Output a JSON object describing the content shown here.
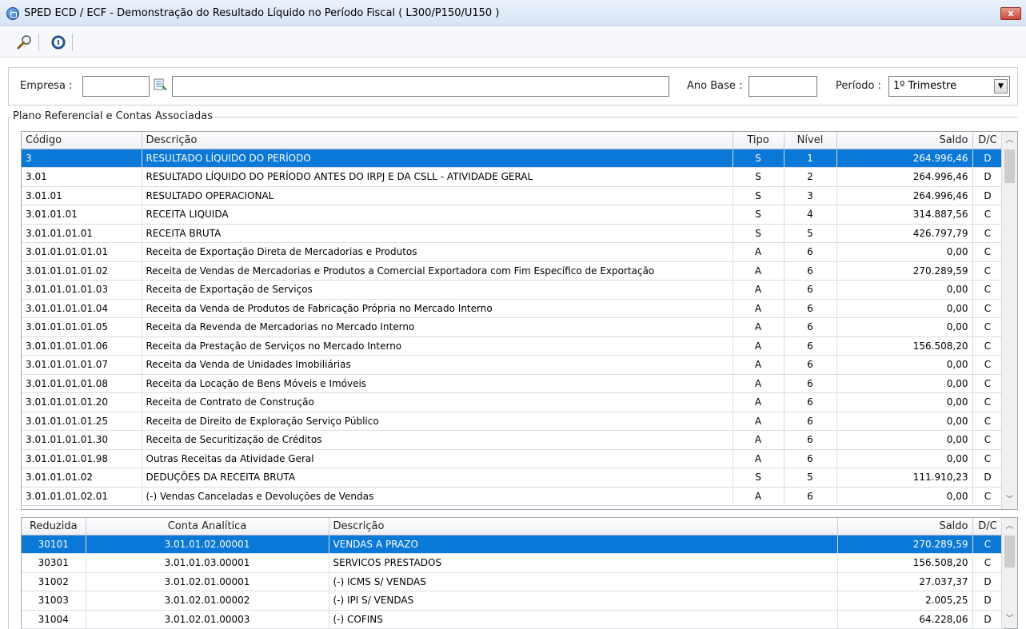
{
  "window": {
    "title": "SPED ECD / ECF - Demonstração do Resultado Líquido no Período Fiscal ( L300/P150/U150 )",
    "close_label": "x"
  },
  "toolbar": {
    "buttons": [
      {
        "icon": "search-icon"
      },
      {
        "icon": "info-icon"
      }
    ]
  },
  "filter": {
    "empresa_label": "Empresa :",
    "empresa_code": "",
    "empresa_name": "",
    "ano_base_label": "Ano Base :",
    "ano_base_value": "",
    "periodo_label": "Período :",
    "periodo_value": "1º Trimestre"
  },
  "group_title": "Plano Referencial e Contas Associadas",
  "grid1": {
    "columns": [
      "Código",
      "Descrição",
      "Tipo",
      "Nível",
      "Saldo",
      "D/C"
    ],
    "rows": [
      [
        "3",
        "RESULTADO LÍQUIDO DO PERÍODO",
        "S",
        "1",
        "264.996,46",
        "D"
      ],
      [
        "3.01",
        "RESULTADO LÍQUIDO DO PERÍODO ANTES DO IRPJ E DA CSLL - ATIVIDADE GERAL",
        "S",
        "2",
        "264.996,46",
        "D"
      ],
      [
        "3.01.01",
        "RESULTADO OPERACIONAL",
        "S",
        "3",
        "264.996,46",
        "D"
      ],
      [
        "3.01.01.01",
        "RECEITA LIQUIDA",
        "S",
        "4",
        "314.887,56",
        "C"
      ],
      [
        "3.01.01.01.01",
        "RECEITA BRUTA",
        "S",
        "5",
        "426.797,79",
        "C"
      ],
      [
        "3.01.01.01.01.01",
        "Receita de Exportação Direta de Mercadorias e Produtos",
        "A",
        "6",
        "0,00",
        "C"
      ],
      [
        "3.01.01.01.01.02",
        "Receita de Vendas de Mercadorias e Produtos a Comercial Exportadora com Fim Específico de Exportação",
        "A",
        "6",
        "270.289,59",
        "C"
      ],
      [
        "3.01.01.01.01.03",
        "Receita de Exportação de Serviços",
        "A",
        "6",
        "0,00",
        "C"
      ],
      [
        "3.01.01.01.01.04",
        "Receita da Venda de Produtos de Fabricação Própria no Mercado Interno",
        "A",
        "6",
        "0,00",
        "C"
      ],
      [
        "3.01.01.01.01.05",
        "Receita da Revenda de Mercadorias no Mercado Interno",
        "A",
        "6",
        "0,00",
        "C"
      ],
      [
        "3.01.01.01.01.06",
        "Receita da Prestação de Serviços no Mercado Interno",
        "A",
        "6",
        "156.508,20",
        "C"
      ],
      [
        "3.01.01.01.01.07",
        "Receita da Venda de Unidades Imobiliárias",
        "A",
        "6",
        "0,00",
        "C"
      ],
      [
        "3.01.01.01.01.08",
        "Receita da Locação de Bens Móveis e Imóveis",
        "A",
        "6",
        "0,00",
        "C"
      ],
      [
        "3.01.01.01.01.20",
        "Receita de Contrato de Construção",
        "A",
        "6",
        "0,00",
        "C"
      ],
      [
        "3.01.01.01.01.25",
        "Receita de Direito de Exploração Serviço Público",
        "A",
        "6",
        "0,00",
        "C"
      ],
      [
        "3.01.01.01.01.30",
        "Receita de Securitização de Créditos",
        "A",
        "6",
        "0,00",
        "C"
      ],
      [
        "3.01.01.01.01.98",
        "Outras Receitas da Atividade Geral",
        "A",
        "6",
        "0,00",
        "C"
      ],
      [
        "3.01.01.01.02",
        "DEDUÇÕES DA RECEITA BRUTA",
        "S",
        "5",
        "111.910,23",
        "D"
      ],
      [
        "3.01.01.01.02.01",
        "(-) Vendas Canceladas e Devoluções de Vendas",
        "A",
        "6",
        "0,00",
        "C"
      ]
    ]
  },
  "grid2": {
    "columns": [
      "Reduzida",
      "Conta Analítica",
      "Descrição",
      "Saldo",
      "D/C"
    ],
    "rows": [
      [
        "30101",
        "3.01.01.02.00001",
        "VENDAS A PRAZO",
        "270.289,59",
        "C"
      ],
      [
        "30301",
        "3.01.01.03.00001",
        "SERVICOS PRESTADOS",
        "156.508,20",
        "C"
      ],
      [
        "31002",
        "3.01.02.01.00001",
        "(-) ICMS S/ VENDAS",
        "27.037,37",
        "D"
      ],
      [
        "31003",
        "3.01.02.01.00002",
        "(-) IPI S/ VENDAS",
        "2.005,25",
        "D"
      ],
      [
        "31004",
        "3.01.02.01.00003",
        "(-) COFINS",
        "64.228,06",
        "D"
      ]
    ]
  }
}
